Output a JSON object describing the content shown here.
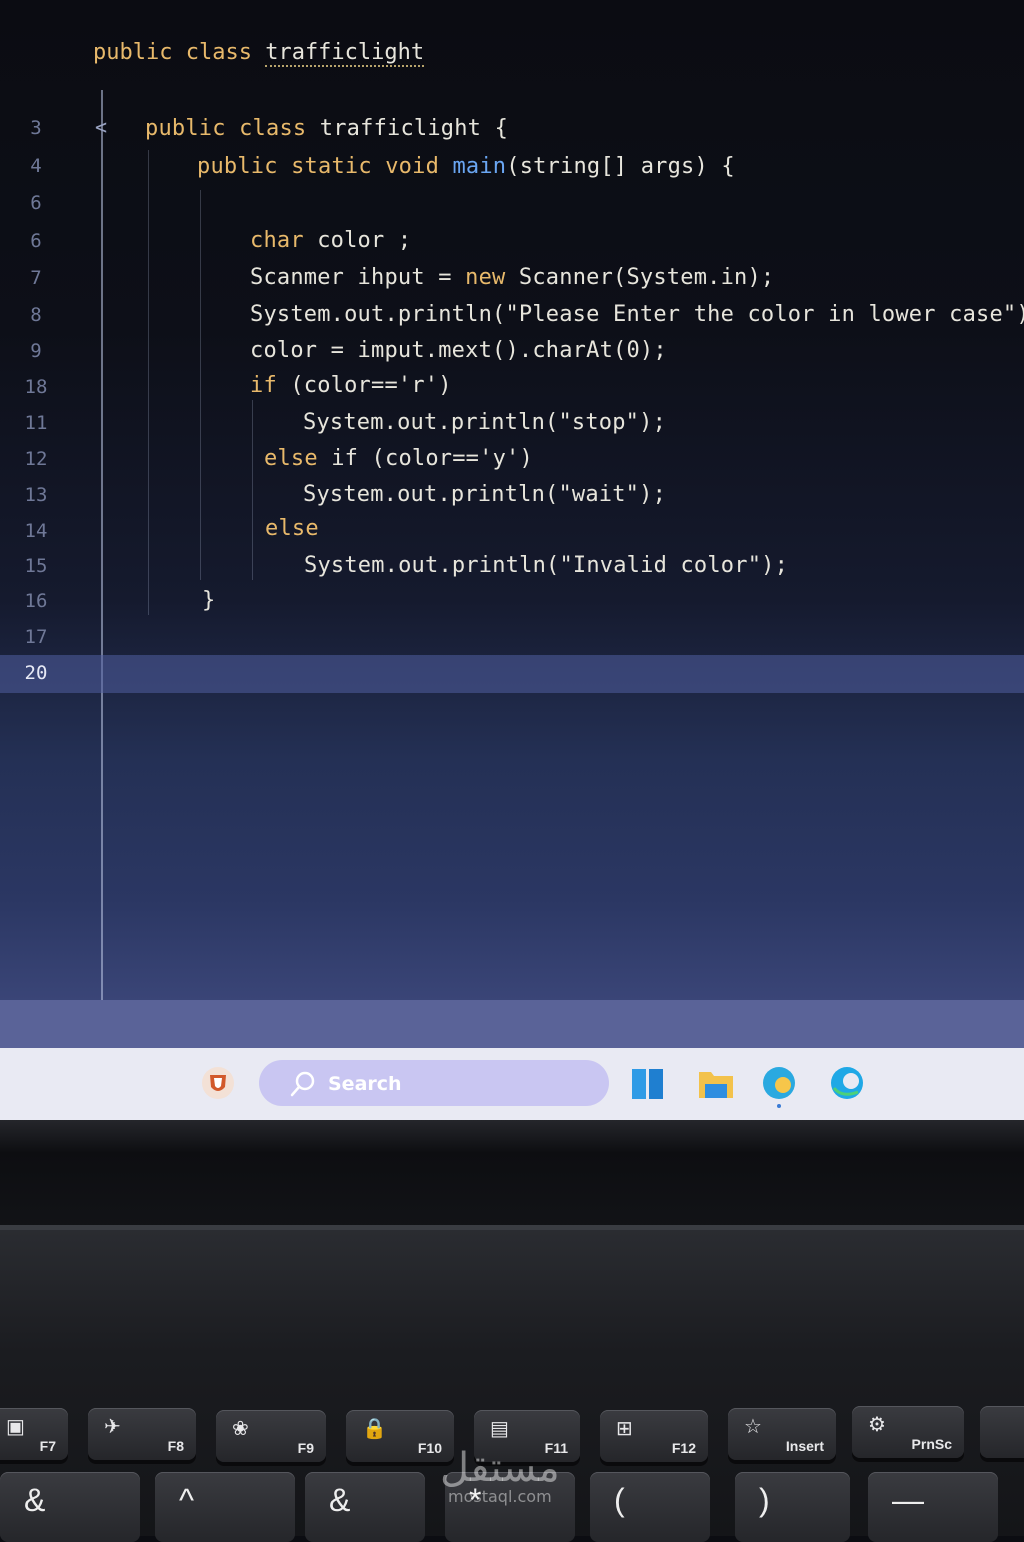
{
  "editor": {
    "title_keywords": "public class",
    "title_name": "trafficlight",
    "fold_marker": "<",
    "line_numbers": [
      "3",
      "4",
      "6",
      "6",
      "7",
      "8",
      "9",
      "18",
      "11",
      "12",
      "13",
      "14",
      "15",
      "16",
      "17",
      "20"
    ],
    "current_line": "20",
    "lines": [
      {
        "kw": "public class",
        "rest": " trafficlight {"
      },
      {
        "kw": "public static void",
        "fn": " main",
        "rest": "(string[] args) {"
      },
      {
        "kw": "char",
        "rest": " color ;"
      },
      {
        "pre": "Scanmer ihput = ",
        "kw": "new",
        "rest": " Scanner(System.in);"
      },
      {
        "rest": "System.out.println(\"Please Enter the color in lower case\");"
      },
      {
        "rest": "color = imput.mext().charAt(0);"
      },
      {
        "kw": "if",
        "rest": " (color=='r')"
      },
      {
        "rest": "System.out.println(\"stop\");"
      },
      {
        "kw": "else",
        "rest": " if (color=='y')"
      },
      {
        "rest": "System.out.println(\"wait\");"
      },
      {
        "kw": "else",
        "rest": ""
      },
      {
        "rest": "System.out.println(\"Invalid color\");"
      },
      {
        "rest": "}"
      }
    ]
  },
  "taskbar": {
    "search_label": "Search",
    "icons": [
      "security-app-icon",
      "search-icon",
      "windows-start-icon",
      "file-explorer-icon",
      "edge-canary-icon",
      "edge-icon"
    ]
  },
  "keyboard": {
    "fkeys": [
      {
        "label": "F7",
        "glyph": "▣"
      },
      {
        "label": "F8",
        "glyph": "✈"
      },
      {
        "label": "F9",
        "glyph": "❀"
      },
      {
        "label": "F10",
        "glyph": "🔒"
      },
      {
        "label": "F11",
        "glyph": "▤"
      },
      {
        "label": "F12",
        "glyph": "⊞"
      },
      {
        "label": "Insert",
        "glyph": "☆"
      },
      {
        "label": "PrnSc",
        "glyph": "⚙"
      }
    ],
    "numrow": [
      "&",
      "^",
      "&",
      "*",
      "(",
      ")",
      "—"
    ]
  },
  "watermark": {
    "arabic": "مستقل",
    "latin": "mostaql.com"
  },
  "colors": {
    "keyword": "#e8b96b",
    "function": "#6aa6f2",
    "text": "#e7e5dc",
    "search_bg": "#c9c6f2"
  }
}
